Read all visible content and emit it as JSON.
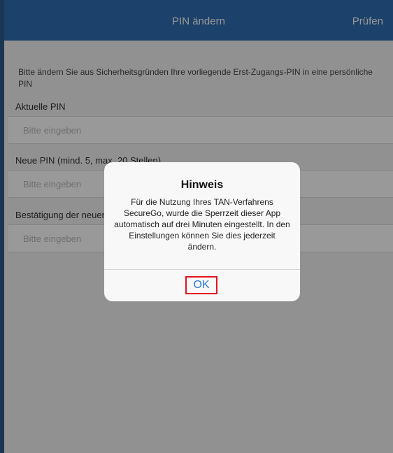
{
  "navbar": {
    "title": "PIN ändern",
    "action_label": "Prüfen",
    "color": "#2f6db1"
  },
  "form": {
    "info_text": "Bitte ändern Sie aus Sicherheitsgründen Ihre vorliegende Erst-Zugangs-PIN in eine persönliche PIN",
    "fields": [
      {
        "label": "Aktuelle PIN",
        "placeholder": "Bitte eingeben"
      },
      {
        "label": "Neue PIN (mind. 5, max. 20 Stellen)",
        "placeholder": "Bitte eingeben"
      },
      {
        "label": "Bestätigung der neuen PIN",
        "placeholder": "Bitte eingeben"
      }
    ]
  },
  "dialog": {
    "title": "Hinweis",
    "message": "Für die Nutzung Ihres TAN-Verfahrens SecureGo, wurde die Sperrzeit dieser App automatisch auf drei Minuten eingestellt. In den Einstellungen können Sie dies jederzeit ändern.",
    "ok_label": "OK",
    "highlight_color": "#e0141e"
  }
}
